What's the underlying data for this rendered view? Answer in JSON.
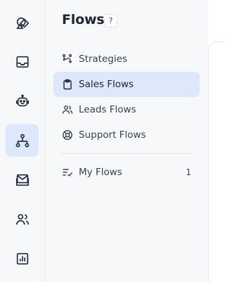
{
  "rail": {
    "items": [
      {
        "icon": "shapes-icon",
        "active": false
      },
      {
        "icon": "inbox-icon",
        "active": false
      },
      {
        "icon": "bot-icon",
        "active": false
      },
      {
        "icon": "flows-icon",
        "active": true
      },
      {
        "icon": "mail-icon",
        "active": false
      },
      {
        "icon": "users-icon",
        "active": false
      },
      {
        "icon": "reports-icon",
        "active": false
      }
    ]
  },
  "panel": {
    "title": "Flows",
    "help": "?",
    "items": [
      {
        "label": "Strategies",
        "icon": "strategy-icon",
        "active": false
      },
      {
        "label": "Sales Flows",
        "icon": "clipboard-icon",
        "active": true
      },
      {
        "label": "Leads Flows",
        "icon": "leads-icon",
        "active": false
      },
      {
        "label": "Support Flows",
        "icon": "lifebuoy-icon",
        "active": false
      }
    ],
    "my_flows": {
      "label": "My Flows",
      "icon": "list-check-icon",
      "count": "1"
    }
  },
  "colors": {
    "active_bg": "#dde8fb",
    "icon": "#1f2a3d",
    "panel_bg": "#f7f8fa"
  }
}
